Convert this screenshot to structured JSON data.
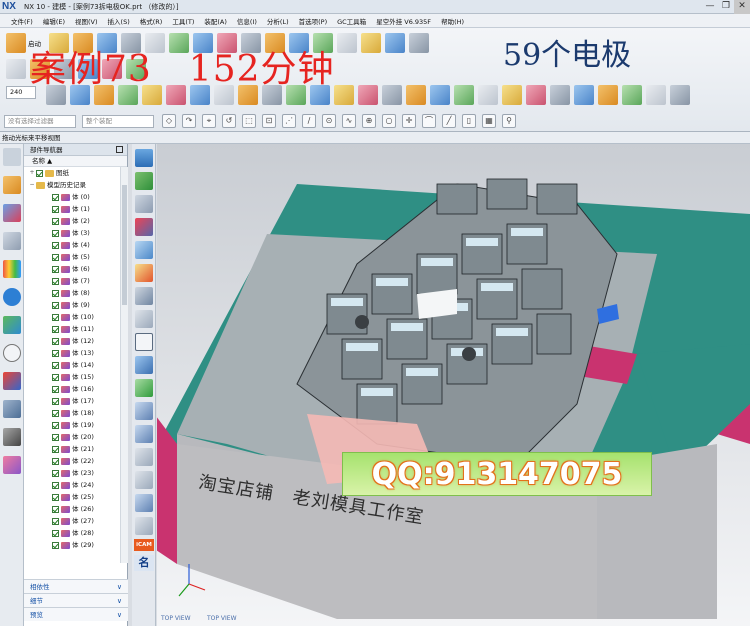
{
  "window": {
    "app_logo": "NX",
    "title": "NX 10 - 建模 - [案例73拆电极OK.prt （修改的）]",
    "controls": [
      "—",
      "❐",
      "✕"
    ]
  },
  "menu": {
    "items": [
      "文件(F)",
      "编辑(E)",
      "视图(V)",
      "插入(S)",
      "格式(R)",
      "工具(T)",
      "装配(A)",
      "信息(I)",
      "分析(L)",
      "首选项(P)",
      "GC工具箱",
      "星空外挂 V6.935F",
      "帮助(H)"
    ]
  },
  "toolbar": {
    "start_label": "启动",
    "zoom_value": "240",
    "selection_filter_placeholder": "没有选择过滤器",
    "assembly_scope_placeholder": "整个装配"
  },
  "overlay": {
    "title": "案例73　152分钟",
    "count": "59个电极"
  },
  "statusline": {
    "text": "拖动光标来平移视图"
  },
  "navigator": {
    "title": "部件导航器",
    "column_name": "名称",
    "drawing_label": "图纸",
    "history_label": "模型历史记录",
    "bodies": [
      "体 (0)",
      "体 (1)",
      "体 (2)",
      "体 (3)",
      "体 (4)",
      "体 (5)",
      "体 (6)",
      "体 (7)",
      "体 (8)",
      "体 (9)",
      "体 (10)",
      "体 (11)",
      "体 (12)",
      "体 (13)",
      "体 (14)",
      "体 (15)",
      "体 (16)",
      "体 (17)",
      "体 (18)",
      "体 (19)",
      "体 (20)",
      "体 (21)",
      "体 (22)",
      "体 (23)",
      "体 (24)",
      "体 (25)",
      "体 (26)",
      "体 (27)",
      "体 (28)",
      "体 (29)"
    ],
    "panels": [
      "相依性",
      "细节",
      "预览"
    ]
  },
  "vtoolbar": {
    "icam_label": "iCAM",
    "name_label": "名"
  },
  "viewport": {
    "view_labels": [
      "TOP VIEW",
      "TOP VIEW"
    ],
    "qq_text": "QQ:913147075",
    "shop_text": "淘宝店铺　老刘模具工作室"
  }
}
